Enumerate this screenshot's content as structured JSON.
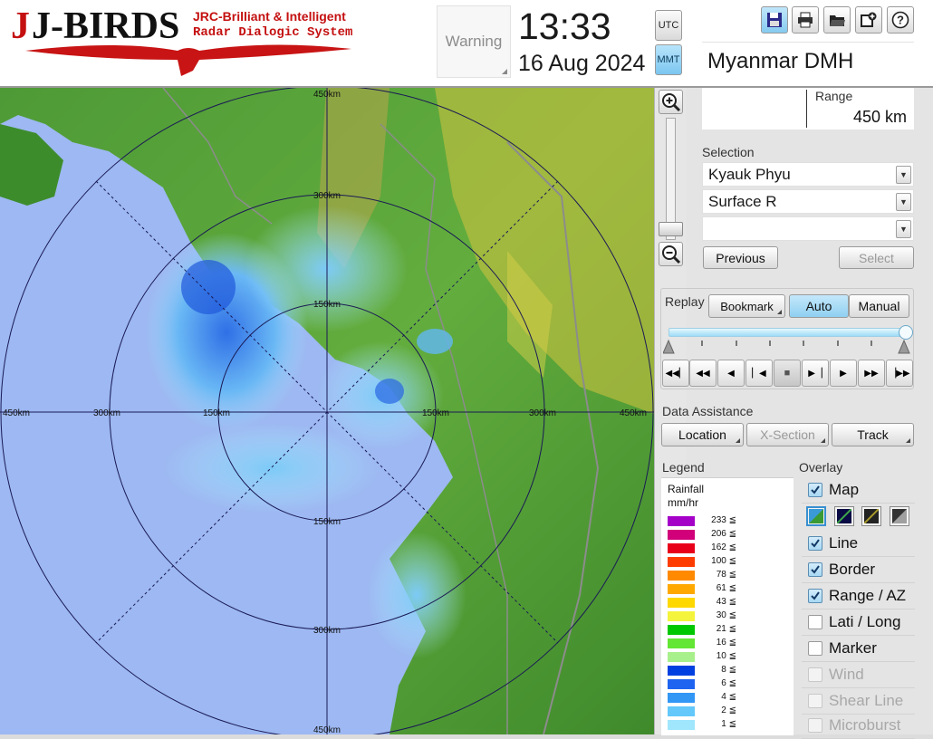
{
  "header": {
    "logo_text": "J-BIRDS",
    "logo_line1": "JRC-Brilliant & Intelligent",
    "logo_line2": "Radar Dialogic System",
    "warning_label": "Warning",
    "time": "13:33",
    "date": "16 Aug 2024",
    "tz_utc": "UTC",
    "tz_mmt": "MMT",
    "station": "Myanmar DMH"
  },
  "toolbar": {
    "icons": [
      "save-icon",
      "print-icon",
      "folder-open-icon",
      "add-window-icon",
      "help-icon"
    ]
  },
  "range": {
    "label": "Range",
    "value": "450 km"
  },
  "selection": {
    "label": "Selection",
    "site": "Kyauk Phyu",
    "product": "Surface R",
    "third": "",
    "previous": "Previous",
    "select": "Select"
  },
  "replay": {
    "label": "Replay",
    "bookmark": "Bookmark",
    "auto": "Auto",
    "manual": "Manual",
    "slider_position": 1.0
  },
  "data_assistance": {
    "label": "Data Assistance",
    "location": "Location",
    "xsection": "X-Section",
    "track": "Track"
  },
  "legend": {
    "label": "Legend",
    "title1": "Rainfall",
    "title2": "mm/hr",
    "items": [
      {
        "color": "#a400c8",
        "value": "233 ≦"
      },
      {
        "color": "#d1007a",
        "value": "206 ≦"
      },
      {
        "color": "#e8001a",
        "value": "162 ≦"
      },
      {
        "color": "#ff3c00",
        "value": "100 ≦"
      },
      {
        "color": "#ff8a00",
        "value": "78 ≦"
      },
      {
        "color": "#ffa800",
        "value": "61 ≦"
      },
      {
        "color": "#ffd800",
        "value": "43 ≦"
      },
      {
        "color": "#f4f43c",
        "value": "30 ≦"
      },
      {
        "color": "#00c800",
        "value": "21 ≦"
      },
      {
        "color": "#64e634",
        "value": "16 ≦"
      },
      {
        "color": "#a8f08c",
        "value": "10 ≦"
      },
      {
        "color": "#0040e0",
        "value": "8 ≦"
      },
      {
        "color": "#1e64f0",
        "value": "6 ≦"
      },
      {
        "color": "#3296f5",
        "value": "4 ≦"
      },
      {
        "color": "#64c8fa",
        "value": "2 ≦"
      },
      {
        "color": "#a0e6fc",
        "value": "1 ≦"
      }
    ]
  },
  "overlay": {
    "label": "Overlay",
    "items": [
      {
        "label": "Map",
        "checked": true,
        "enabled": true
      },
      {
        "label": "Line",
        "checked": true,
        "enabled": true
      },
      {
        "label": "Border",
        "checked": true,
        "enabled": true
      },
      {
        "label": "Range / AZ",
        "checked": true,
        "enabled": true
      },
      {
        "label": "Lati / Long",
        "checked": false,
        "enabled": true
      },
      {
        "label": "Marker",
        "checked": false,
        "enabled": true
      },
      {
        "label": "Wind",
        "checked": false,
        "enabled": false
      },
      {
        "label": "Shear Line",
        "checked": false,
        "enabled": false
      },
      {
        "label": "Microburst",
        "checked": false,
        "enabled": false
      }
    ]
  },
  "radar": {
    "range_labels": {
      "n450": "450km",
      "n300": "300km",
      "n150": "150km",
      "s150": "150km",
      "s300": "300km",
      "s450": "450km",
      "w450": "450km",
      "w300": "300km",
      "w150": "150km",
      "e150": "150km",
      "e300": "300km",
      "e450": "450km"
    }
  }
}
